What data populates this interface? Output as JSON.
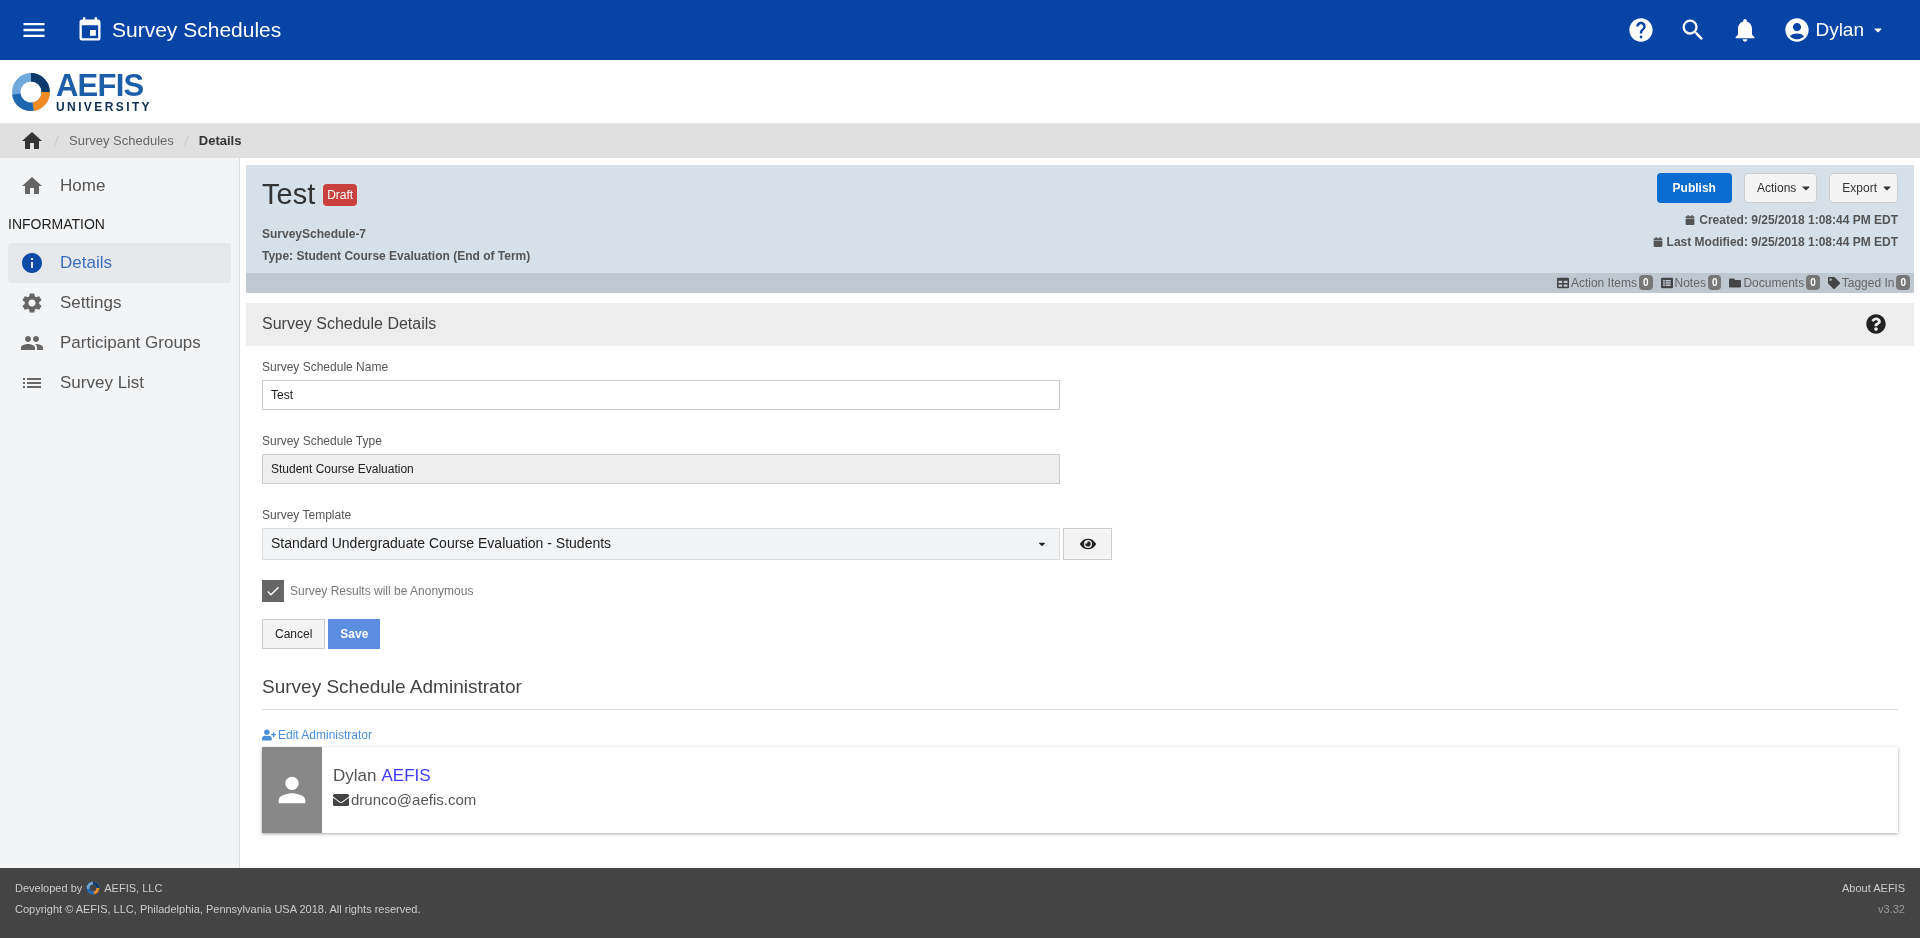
{
  "app_bar": {
    "title": "Survey Schedules",
    "user": "Dylan"
  },
  "logo": {
    "name": "AEFIS",
    "subtitle": "UNIVERSITY"
  },
  "breadcrumb": [
    "Survey Schedules",
    "Details"
  ],
  "sidebar": {
    "home": "Home",
    "section": "INFORMATION",
    "items": [
      {
        "label": "Details",
        "selected": true
      },
      {
        "label": "Settings",
        "selected": false
      },
      {
        "label": "Participant Groups",
        "selected": false
      },
      {
        "label": "Survey List",
        "selected": false
      }
    ]
  },
  "header": {
    "title": "Test",
    "status": "Draft",
    "id": "SurveySchedule-7",
    "type": "Type: Student Course Evaluation (End of Term)",
    "buttons": [
      "Publish",
      "Actions",
      "Export"
    ],
    "created": "Created: 9/25/2018 1:08:44 PM EDT",
    "modified": "Last Modified: 9/25/2018 1:08:44 PM EDT",
    "counters": [
      {
        "label": "Action Items",
        "count": "0"
      },
      {
        "label": "Notes",
        "count": "0"
      },
      {
        "label": "Documents",
        "count": "0"
      },
      {
        "label": "Tagged In",
        "count": "0"
      }
    ]
  },
  "section_title": "Survey Schedule Details",
  "form": {
    "name_label": "Survey Schedule Name",
    "name_value": "Test",
    "type_label": "Survey Schedule Type",
    "type_value": "Student Course Evaluation",
    "template_label": "Survey Template",
    "template_value": "Standard Undergraduate Course Evaluation - Students",
    "anonymous": {
      "label": "Survey Results will be Anonymous",
      "checked": true
    },
    "buttons": [
      "Cancel",
      "Save"
    ]
  },
  "administrator": {
    "title": "Survey Schedule Administrator",
    "edit_link": "Edit Administrator",
    "first_name": "Dylan",
    "last_name": "AEFIS",
    "email": "drunco@aefis.com"
  },
  "footer": {
    "developed_by": "Developed by",
    "company": "AEFIS, LLC",
    "copyright": "Copyright © AEFIS, LLC, Philadelphia, Pennsylvania USA 2018. All rights reserved.",
    "about": "About AEFIS",
    "version": "v3.32"
  }
}
